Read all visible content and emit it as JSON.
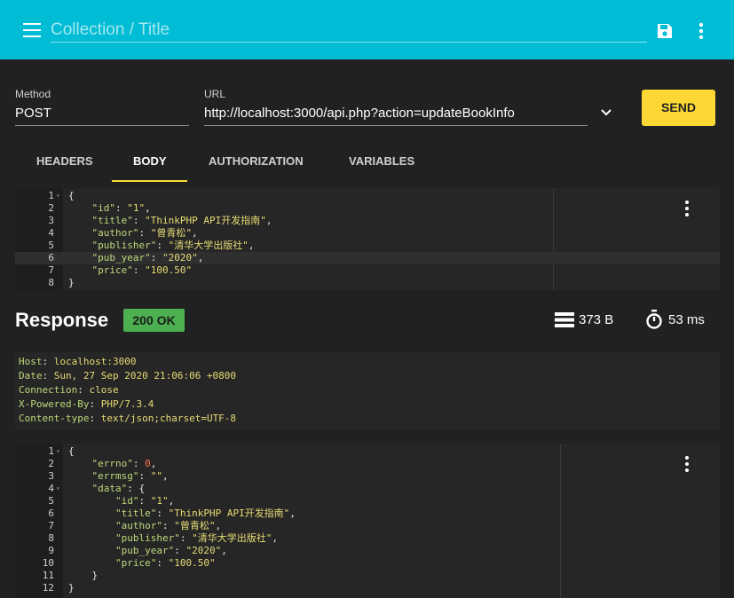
{
  "header": {
    "title_placeholder": "Collection / Title",
    "menu_icon": "hamburger-menu-icon",
    "save_icon": "save-icon",
    "more_icon": "more-vert-icon",
    "bg_color": "#00bcd4"
  },
  "request": {
    "method_label": "Method",
    "method": "POST",
    "url_label": "URL",
    "url": "http://localhost:3000/api.php?action=updateBookInfo",
    "send_label": "SEND",
    "send_color": "#fdd835"
  },
  "tabs": [
    {
      "label": "HEADERS",
      "active": false
    },
    {
      "label": "BODY",
      "active": true
    },
    {
      "label": "AUTHORIZATION",
      "active": false
    },
    {
      "label": "VARIABLES",
      "active": false
    }
  ],
  "body_editor": {
    "lines": [
      {
        "n": "1",
        "fold": true,
        "tokens": [
          [
            "pun",
            "{"
          ]
        ]
      },
      {
        "n": "2",
        "tokens": [
          [
            "key",
            "    \"id\""
          ],
          [
            "pun",
            ": "
          ],
          [
            "str",
            "\"1\""
          ],
          [
            "pun",
            ","
          ]
        ]
      },
      {
        "n": "3",
        "tokens": [
          [
            "key",
            "    \"title\""
          ],
          [
            "pun",
            ": "
          ],
          [
            "str",
            "\"ThinkPHP API开发指南\""
          ],
          [
            "pun",
            ","
          ]
        ]
      },
      {
        "n": "4",
        "tokens": [
          [
            "key",
            "    \"author\""
          ],
          [
            "pun",
            ": "
          ],
          [
            "str",
            "\"曾青松\""
          ],
          [
            "pun",
            ","
          ]
        ]
      },
      {
        "n": "5",
        "tokens": [
          [
            "key",
            "    \"publisher\""
          ],
          [
            "pun",
            ": "
          ],
          [
            "str",
            "\"清华大学出版社\""
          ],
          [
            "pun",
            ","
          ]
        ]
      },
      {
        "n": "6",
        "tokens": [
          [
            "key",
            "    \"pub_year\""
          ],
          [
            "pun",
            ": "
          ],
          [
            "str",
            "\"2020\""
          ],
          [
            "pun",
            ","
          ]
        ]
      },
      {
        "n": "7",
        "tokens": [
          [
            "key",
            "    \"price\""
          ],
          [
            "pun",
            ": "
          ],
          [
            "str",
            "\"100.50\""
          ]
        ]
      },
      {
        "n": "8",
        "tokens": [
          [
            "pun",
            "}"
          ]
        ]
      }
    ]
  },
  "response": {
    "title": "Response",
    "status": "200 OK",
    "status_color": "#4caf50",
    "size": "373 B",
    "time": "53 ms",
    "headers": [
      [
        "Host",
        "localhost:3000"
      ],
      [
        "Date",
        "Sun, 27 Sep 2020 21:06:06 +0800"
      ],
      [
        "Connection",
        "close"
      ],
      [
        "X-Powered-By",
        "PHP/7.3.4"
      ],
      [
        "Content-type",
        "text/json;charset=UTF-8"
      ]
    ],
    "body_lines": [
      {
        "n": "1",
        "fold": true,
        "tokens": [
          [
            "pun",
            "{"
          ]
        ]
      },
      {
        "n": "2",
        "tokens": [
          [
            "key",
            "    \"errno\""
          ],
          [
            "pun",
            ": "
          ],
          [
            "num",
            "0"
          ],
          [
            "pun",
            ","
          ]
        ]
      },
      {
        "n": "3",
        "tokens": [
          [
            "key",
            "    \"errmsg\""
          ],
          [
            "pun",
            ": "
          ],
          [
            "str",
            "\"\""
          ],
          [
            "pun",
            ","
          ]
        ]
      },
      {
        "n": "4",
        "fold": true,
        "tokens": [
          [
            "key",
            "    \"data\""
          ],
          [
            "pun",
            ": {"
          ]
        ]
      },
      {
        "n": "5",
        "tokens": [
          [
            "key",
            "        \"id\""
          ],
          [
            "pun",
            ": "
          ],
          [
            "str",
            "\"1\""
          ],
          [
            "pun",
            ","
          ]
        ]
      },
      {
        "n": "6",
        "tokens": [
          [
            "key",
            "        \"title\""
          ],
          [
            "pun",
            ": "
          ],
          [
            "str",
            "\"ThinkPHP API开发指南\""
          ],
          [
            "pun",
            ","
          ]
        ]
      },
      {
        "n": "7",
        "tokens": [
          [
            "key",
            "        \"author\""
          ],
          [
            "pun",
            ": "
          ],
          [
            "str",
            "\"曾青松\""
          ],
          [
            "pun",
            ","
          ]
        ]
      },
      {
        "n": "8",
        "tokens": [
          [
            "key",
            "        \"publisher\""
          ],
          [
            "pun",
            ": "
          ],
          [
            "str",
            "\"清华大学出版社\""
          ],
          [
            "pun",
            ","
          ]
        ]
      },
      {
        "n": "9",
        "tokens": [
          [
            "key",
            "        \"pub_year\""
          ],
          [
            "pun",
            ": "
          ],
          [
            "str",
            "\"2020\""
          ],
          [
            "pun",
            ","
          ]
        ]
      },
      {
        "n": "10",
        "tokens": [
          [
            "key",
            "        \"price\""
          ],
          [
            "pun",
            ": "
          ],
          [
            "str",
            "\"100.50\""
          ]
        ]
      },
      {
        "n": "11",
        "tokens": [
          [
            "pun",
            "    }"
          ]
        ]
      },
      {
        "n": "12",
        "tokens": [
          [
            "pun",
            "}"
          ]
        ]
      }
    ]
  }
}
